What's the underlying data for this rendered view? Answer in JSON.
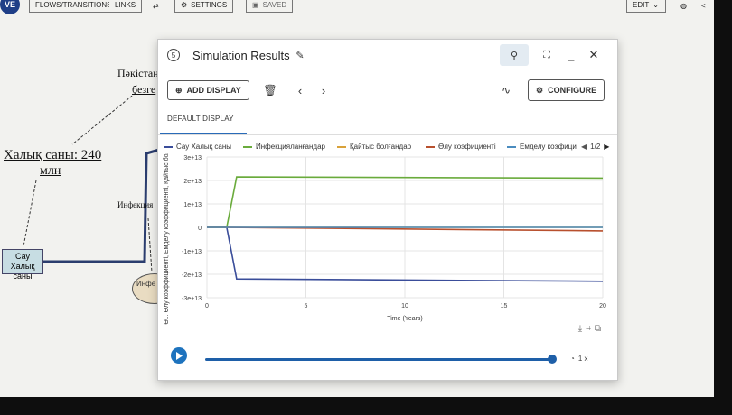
{
  "topbar": {
    "logo": "VE",
    "flows_transitions": "FLOWS/TRANSITIONS",
    "links": "LINKS",
    "settings": "SETTINGS",
    "saved": "SAVED",
    "edit": "EDIT"
  },
  "diagram": {
    "label_top_line1": "Пәкістан",
    "label_top_line2": "безге",
    "population_line1": "Халық саны: 240",
    "population_line2": "млн",
    "node_box": "Сау Халық саны",
    "infection_label": "Инфекция",
    "oval_text": "Инфе кэоэ"
  },
  "dialog": {
    "title": "Simulation Results",
    "add_display": "ADD DISPLAY",
    "configure": "CONFIGURE",
    "tab_default": "DEFAULT DISPLAY",
    "legend_page": "1/2",
    "speed": "1 x",
    "colors": {
      "accent": "#1e73be"
    }
  },
  "chart_data": {
    "type": "line",
    "xlabel": "Time (Years)",
    "ylabel": "Ө... Өлу коэффициенті, Емделу коэффициенті, Қайтыс болғандар",
    "xlim": [
      0,
      20
    ],
    "ylim": [
      -30000000000000.0,
      30000000000000.0
    ],
    "x_ticks": [
      "0",
      "5",
      "10",
      "15",
      "20"
    ],
    "y_ticks": [
      "-3e+13",
      "-2e+13",
      "-1e+13",
      "0",
      "1e+13",
      "2e+13",
      "3e+13"
    ],
    "legend_position": "top",
    "series": [
      {
        "name": "Сау Халық саны",
        "color": "#3a4d9a",
        "points": [
          [
            0,
            0
          ],
          [
            1,
            0
          ],
          [
            1.5,
            -22000000000000.0
          ],
          [
            20,
            -23000000000000.0
          ]
        ]
      },
      {
        "name": "Инфекцияланғандар",
        "color": "#6aab3c",
        "points": [
          [
            0,
            0
          ],
          [
            1,
            0
          ],
          [
            1.5,
            21500000000000.0
          ],
          [
            20,
            21000000000000.0
          ]
        ]
      },
      {
        "name": "Қайтыс болғандар",
        "color": "#d9a23a",
        "points": [
          [
            0,
            0
          ],
          [
            20,
            0
          ]
        ]
      },
      {
        "name": "Өлу коэфициенті",
        "color": "#b8502e",
        "points": [
          [
            0,
            0
          ],
          [
            1,
            0
          ],
          [
            20,
            -1500000000000.0
          ]
        ]
      },
      {
        "name": "Емделу коэфици",
        "color": "#4a8cbf",
        "points": [
          [
            0,
            0
          ],
          [
            20,
            0
          ]
        ]
      }
    ]
  }
}
